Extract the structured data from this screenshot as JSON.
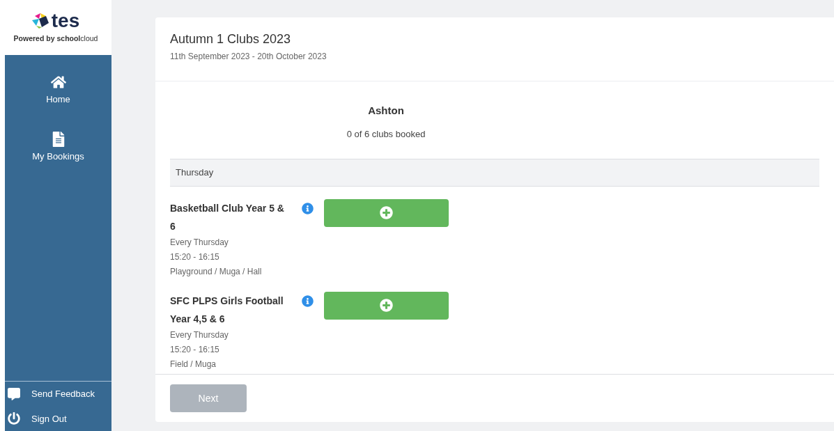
{
  "logo": {
    "word": "tes",
    "tagline_prefix": "Powered by",
    "tagline_bold": "school",
    "tagline_light": "cloud"
  },
  "nav": [
    {
      "kind": "home",
      "label": "Home"
    },
    {
      "kind": "document",
      "label": "My Bookings"
    }
  ],
  "footer_nav": [
    {
      "kind": "feedback",
      "label": "Send Feedback"
    },
    {
      "kind": "power",
      "label": "Sign Out"
    }
  ],
  "header": {
    "title": "Autumn 1 Clubs 2023",
    "dates": "11th September 2023 - 20th October 2023"
  },
  "student": {
    "name": "Ashton",
    "summary": "0 of 6 clubs booked"
  },
  "day": "Thursday",
  "clubs": [
    {
      "name": "Basketball Club Year 5 & 6",
      "frequency": "Every Thursday",
      "time": "15:20 - 16:15",
      "location": "Playground / Muga / Hall"
    },
    {
      "name": "SFC PLPS Girls Football Year 4,5 & 6",
      "frequency": "Every Thursday",
      "time": "15:20 - 16:15",
      "location": "Field / Muga"
    }
  ],
  "next_button": {
    "label": "Next",
    "disabled": true
  }
}
